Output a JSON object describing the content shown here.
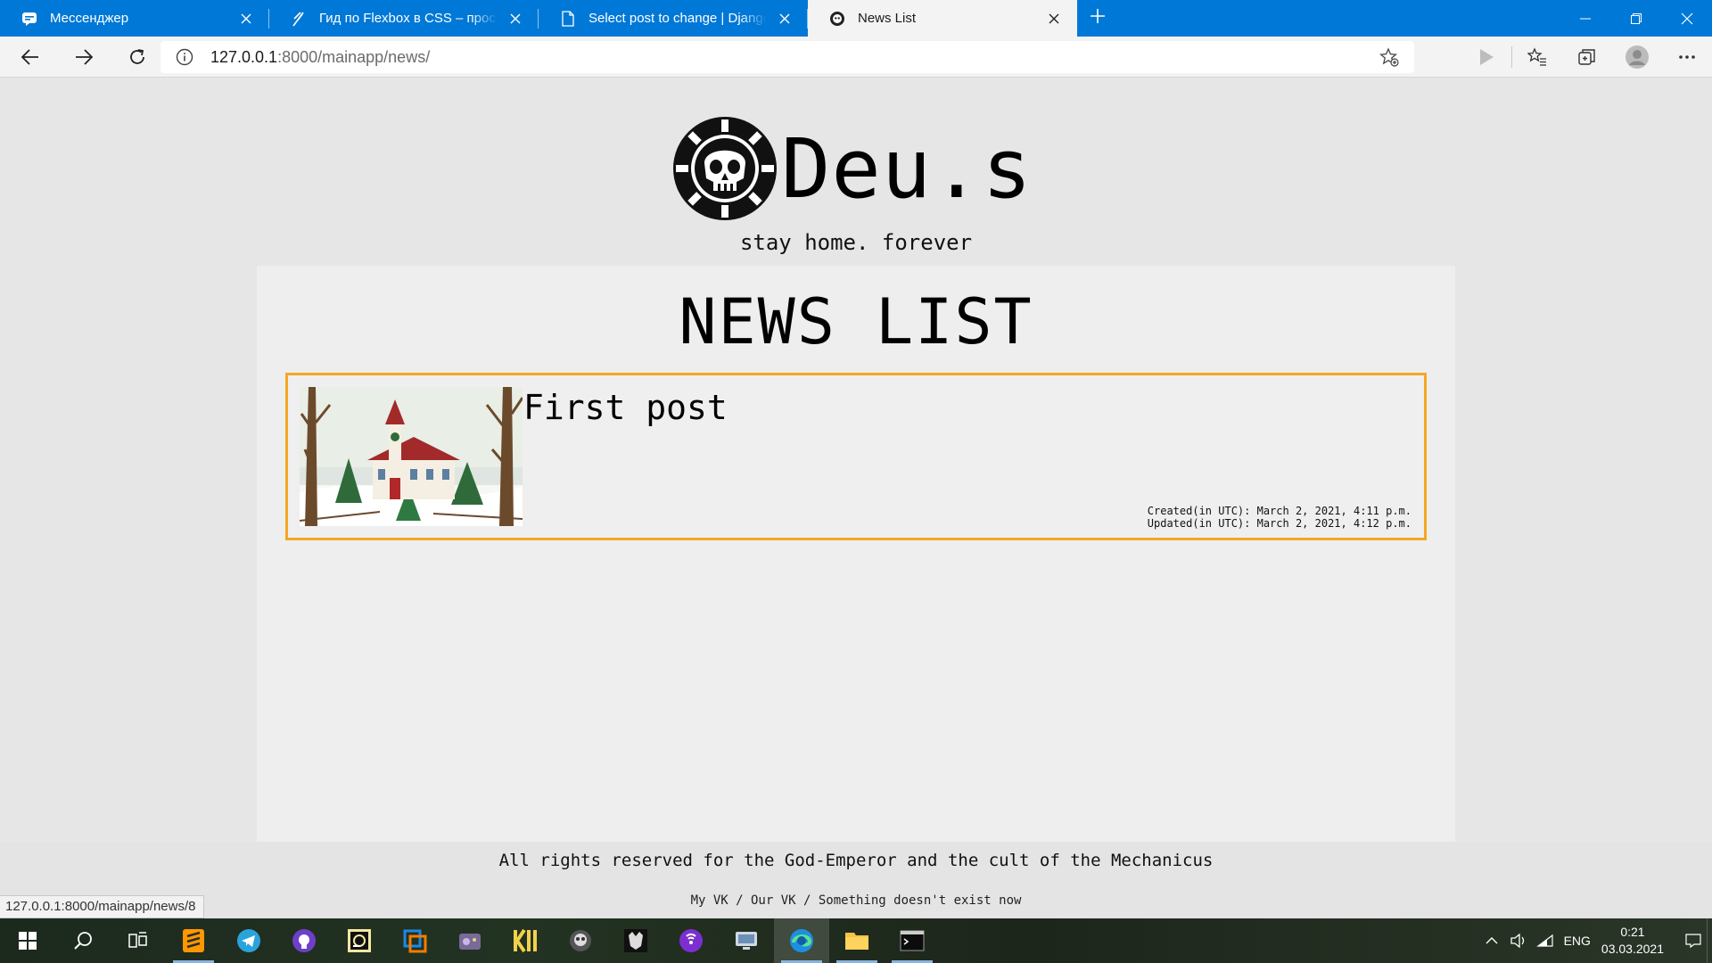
{
  "browser": {
    "tabs": [
      {
        "title": "Мессенджер",
        "icon": "messenger-icon",
        "active": false
      },
      {
        "title": "Гид по Flexbox в CSS – просто и",
        "icon": "feather-icon",
        "active": false
      },
      {
        "title": "Select post to change | Django s",
        "icon": "page-icon",
        "active": false
      },
      {
        "title": "News List",
        "icon": "skull-cog-icon",
        "active": true
      }
    ],
    "address": {
      "host": "127.0.0.1",
      "rest": ":8000/mainapp/news/"
    }
  },
  "site": {
    "logo_text": "Deu.s",
    "tagline": "stay home. forever",
    "page_title": "NEWS LIST",
    "news": [
      {
        "title": "First post",
        "created": "Created(in UTC): March 2, 2021, 4:11 p.m.",
        "updated": "Updated(in UTC): March 2, 2021, 4:12 p.m."
      }
    ],
    "footer_text": "All rights reserved for the God-Emperor and the cult of the Mechanicus",
    "footer_links": "My VK / Our VK / Something doesn't exist now"
  },
  "status_bar_url": "127.0.0.1:8000/mainapp/news/8",
  "taskbar": {
    "language": "ENG",
    "time": "0:21",
    "date": "03.03.2021"
  },
  "colors": {
    "titlebar": "#0078d7",
    "card_border": "#f5a623"
  }
}
